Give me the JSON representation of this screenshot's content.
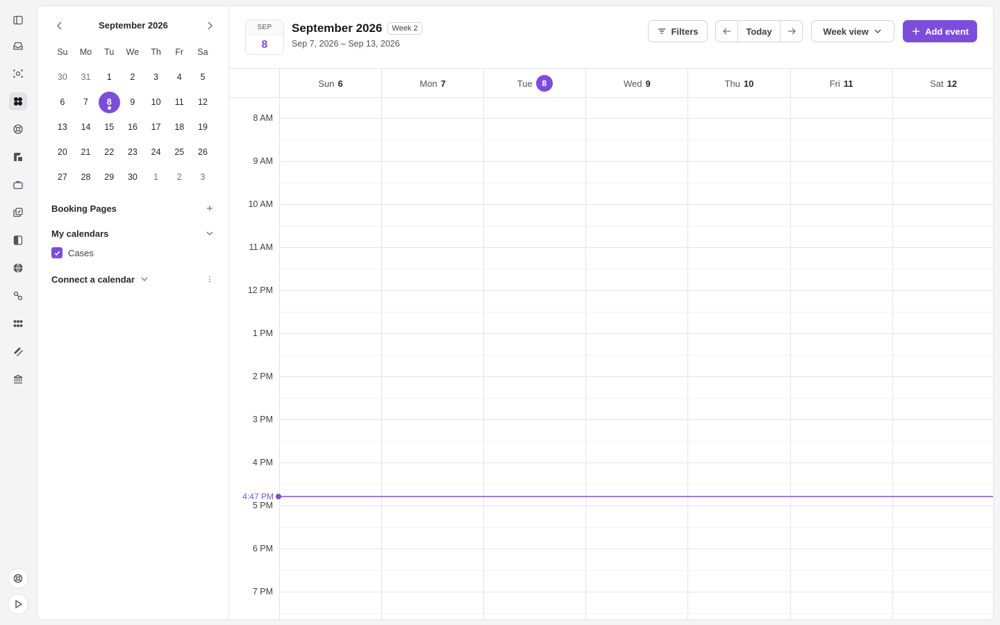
{
  "rail": {
    "icons": [
      "sidebar-toggle-icon",
      "inbox-icon",
      "scan-icon",
      "dashboard-icon",
      "support-icon",
      "studio-icon",
      "briefcase-icon",
      "tasks-icon",
      "notes-icon",
      "globe-icon",
      "integrations-icon",
      "apps-icon",
      "tools-icon",
      "bank-icon"
    ],
    "active": "dashboard-icon",
    "bottom_icons": [
      "help-icon",
      "play-icon"
    ]
  },
  "mini_calendar": {
    "title": "September 2026",
    "weekdays": [
      "Su",
      "Mo",
      "Tu",
      "We",
      "Th",
      "Fr",
      "Sa"
    ],
    "weeks": [
      [
        "30",
        "31",
        "1",
        "2",
        "3",
        "4",
        "5"
      ],
      [
        "6",
        "7",
        "8",
        "9",
        "10",
        "11",
        "12"
      ],
      [
        "13",
        "14",
        "15",
        "16",
        "17",
        "18",
        "19"
      ],
      [
        "20",
        "21",
        "22",
        "23",
        "24",
        "25",
        "26"
      ],
      [
        "27",
        "28",
        "29",
        "30",
        "1",
        "2",
        "3"
      ]
    ],
    "selected_day": "8"
  },
  "sidebar": {
    "booking_pages": "Booking Pages",
    "my_calendars": "My calendars",
    "calendars": [
      {
        "label": "Cases",
        "checked": true
      }
    ],
    "connect": "Connect a calendar"
  },
  "header": {
    "badge_month": "SEP",
    "badge_day": "8",
    "title": "September 2026",
    "week_tag": "Week 2",
    "range": "Sep 7, 2026 – Sep 13, 2026",
    "filters_label": "Filters",
    "today_label": "Today",
    "view_label": "Week view",
    "add_label": "Add event"
  },
  "week": {
    "days": [
      {
        "dow": "Sun",
        "num": "6",
        "today": false
      },
      {
        "dow": "Mon",
        "num": "7",
        "today": false
      },
      {
        "dow": "Tue",
        "num": "8",
        "today": true
      },
      {
        "dow": "Wed",
        "num": "9",
        "today": false
      },
      {
        "dow": "Thu",
        "num": "10",
        "today": false
      },
      {
        "dow": "Fri",
        "num": "11",
        "today": false
      },
      {
        "dow": "Sat",
        "num": "12",
        "today": false
      }
    ],
    "hours": [
      "8 AM",
      "9 AM",
      "10 AM",
      "11 AM",
      "12 PM",
      "1 PM",
      "2 PM",
      "3 PM",
      "4 PM",
      "5 PM",
      "6 PM",
      "7 PM"
    ],
    "now_label": "4:47 PM",
    "now_hours": 16.783
  },
  "colors": {
    "accent": "#7c4ddb",
    "border": "#e4e4e7"
  }
}
